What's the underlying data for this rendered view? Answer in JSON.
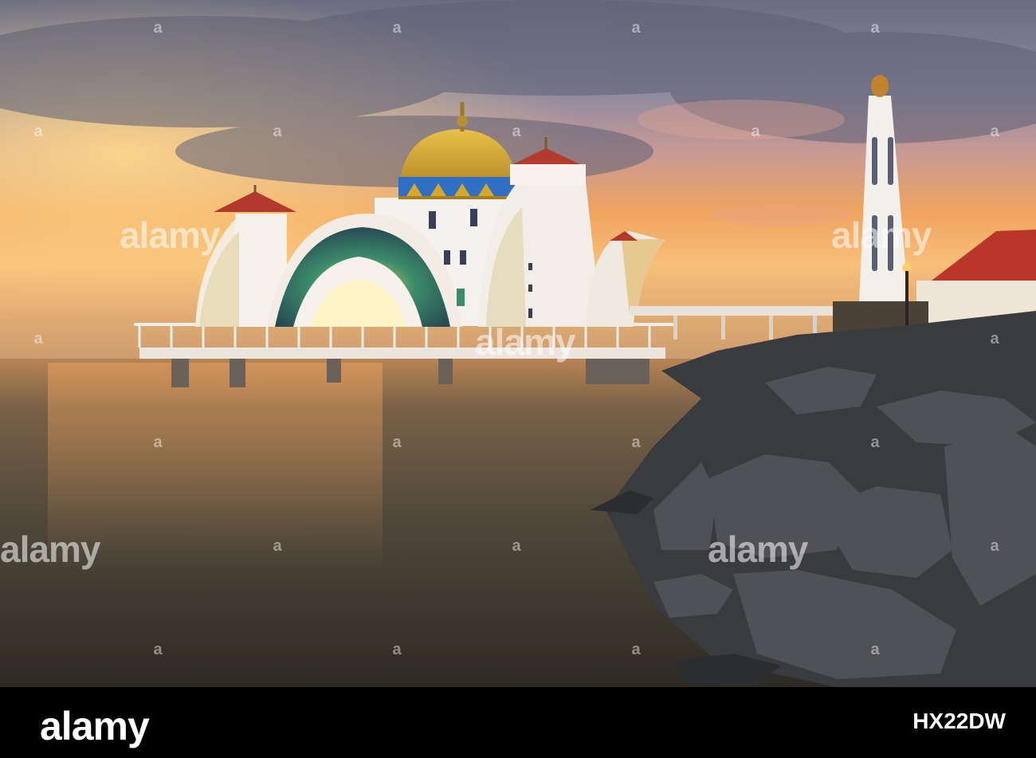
{
  "watermark": {
    "brand": "alamy",
    "mark": "a"
  },
  "footer": {
    "logo": "alamy",
    "image_id": "HX22DW"
  },
  "colors": {
    "sky_top": "#6e6f84",
    "sunset_glow": "#f3a85c",
    "water": "#4a4235",
    "dome_gold": "#d5a72e",
    "dome_band": "#2f6fc4",
    "roof_red": "#b23b2d",
    "rocks": "#3b3c40",
    "bar": "#000000"
  }
}
